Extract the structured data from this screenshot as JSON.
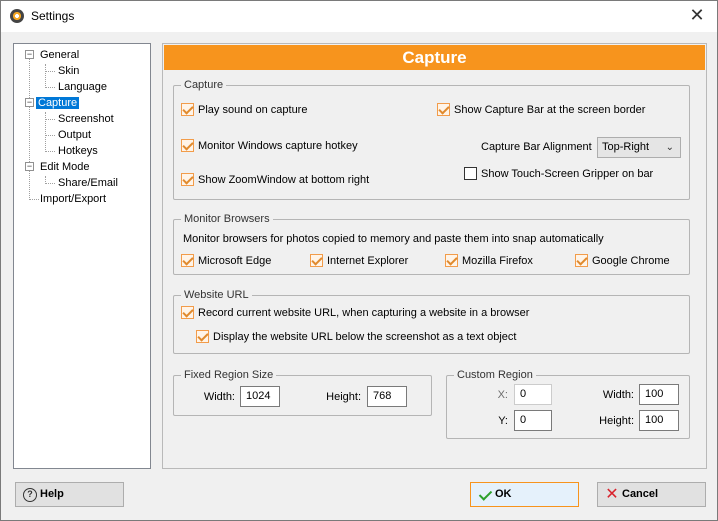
{
  "window": {
    "title": "Settings",
    "close_glyph": "✕"
  },
  "tree": {
    "items": [
      {
        "label": "General",
        "expander": "−"
      },
      {
        "label": "Skin"
      },
      {
        "label": "Language"
      },
      {
        "label": "Capture",
        "expander": "−",
        "selected": true
      },
      {
        "label": "Screenshot"
      },
      {
        "label": "Output"
      },
      {
        "label": "Hotkeys"
      },
      {
        "label": "Edit Mode",
        "expander": "−"
      },
      {
        "label": "Share/Email"
      },
      {
        "label": "Import/Export"
      }
    ]
  },
  "panel": {
    "header": "Capture",
    "header_color": "#f7941d"
  },
  "capture": {
    "title": "Capture",
    "play_sound": {
      "label": "Play sound on capture",
      "checked": true
    },
    "show_capture_bar": {
      "label": "Show Capture Bar at the screen border",
      "checked": true
    },
    "monitor_hotkey": {
      "label": "Monitor Windows capture hotkey",
      "checked": true
    },
    "bar_alignment_label": "Capture Bar Alignment",
    "bar_alignment_value": "Top-Right",
    "show_zoom": {
      "label": "Show ZoomWindow at bottom right",
      "checked": true
    },
    "touch_gripper": {
      "label": "Show Touch-Screen Gripper on bar",
      "checked": false
    }
  },
  "browsers": {
    "title": "Monitor Browsers",
    "description": "Monitor browsers for photos copied to memory and paste them into snap automatically",
    "edge": {
      "label": "Microsoft Edge",
      "checked": true
    },
    "ie": {
      "label": "Internet Explorer",
      "checked": true
    },
    "firefox": {
      "label": "Mozilla Firefox",
      "checked": true
    },
    "chrome": {
      "label": "Google Chrome",
      "checked": true
    }
  },
  "website": {
    "title": "Website URL",
    "record_url": {
      "label": "Record current website URL, when capturing a website in a browser",
      "checked": true
    },
    "display_url": {
      "label": "Display the website URL below the screenshot as a text object",
      "checked": true
    }
  },
  "fixed_region": {
    "title": "Fixed Region Size",
    "width_label": "Width:",
    "width_value": "1024",
    "height_label": "Height:",
    "height_value": "768"
  },
  "custom_region": {
    "title": "Custom Region",
    "x_label": "X:",
    "x_value": "0",
    "y_label": "Y:",
    "y_value": "0",
    "width_label": "Width:",
    "width_value": "100",
    "height_label": "Height:",
    "height_value": "100"
  },
  "buttons": {
    "help": "Help",
    "ok": "OK",
    "cancel": "Cancel",
    "help_glyph": "?",
    "cancel_glyph": "✕"
  },
  "icons": {
    "app": "app-icon",
    "close": "close-icon",
    "help": "help-icon",
    "ok": "check-icon",
    "cancel": "cancel-x-icon"
  }
}
